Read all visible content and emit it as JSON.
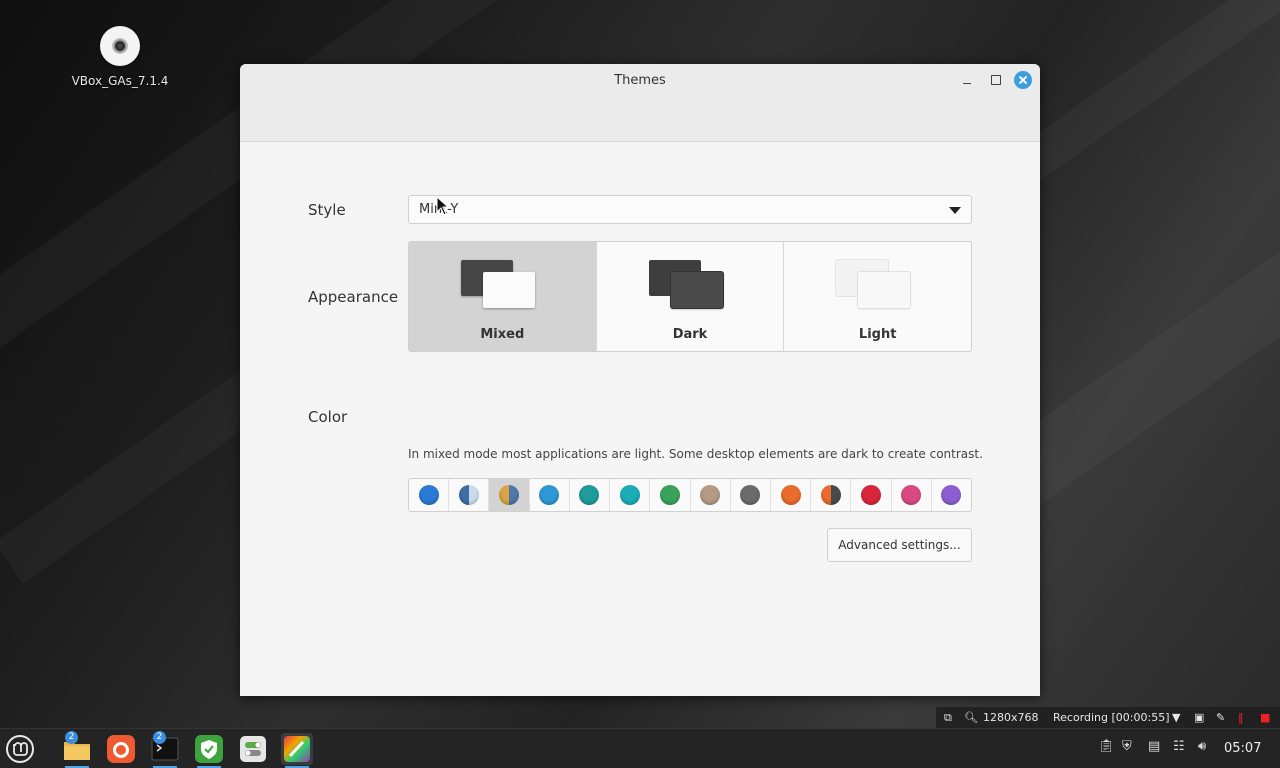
{
  "desktop": {
    "icon_label": "VBox_GAs_7.1.4"
  },
  "window": {
    "title": "Themes"
  },
  "style_row": {
    "label": "Style",
    "value": "Mint-Y"
  },
  "appearance_row": {
    "label": "Appearance",
    "options": [
      {
        "label": "Mixed",
        "selected": true
      },
      {
        "label": "Dark",
        "selected": false
      },
      {
        "label": "Light",
        "selected": false
      }
    ],
    "hint": "In mixed mode most applications are light. Some desktop elements are dark to create contrast."
  },
  "color_row": {
    "label": "Color",
    "swatches": [
      {
        "name": "blue",
        "color": "#2a7bd4"
      },
      {
        "name": "aqua-split",
        "color": "#3d6fa6"
      },
      {
        "name": "sand-split",
        "color": "#d9a441",
        "selected": true
      },
      {
        "name": "sky",
        "color": "#2f98d5"
      },
      {
        "name": "teal",
        "color": "#1f9b9b"
      },
      {
        "name": "cyan",
        "color": "#1bacb8"
      },
      {
        "name": "green",
        "color": "#3aa35a"
      },
      {
        "name": "tan",
        "color": "#b59a85"
      },
      {
        "name": "grey",
        "color": "#6b6b6b"
      },
      {
        "name": "orange",
        "color": "#ea6b2b"
      },
      {
        "name": "orange-split",
        "color": "#e96a2e"
      },
      {
        "name": "red",
        "color": "#d9263c"
      },
      {
        "name": "pink",
        "color": "#d94a82"
      },
      {
        "name": "purple",
        "color": "#8c5ed2"
      }
    ]
  },
  "advanced_button": "Advanced settings...",
  "recording_bar": {
    "resolution": "1280x768",
    "status": "Recording [00:00:55]"
  },
  "taskbar": {
    "files_badge": "2",
    "terminal_badge": "2",
    "clock": "05:07"
  }
}
